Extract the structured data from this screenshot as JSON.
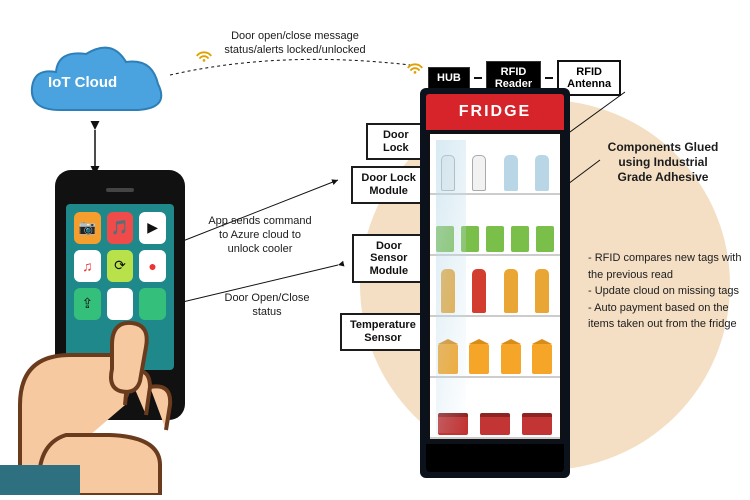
{
  "cloud": {
    "label": "IoT Cloud"
  },
  "hub_row": {
    "hub": "HUB",
    "rfid_reader": "RFID\nReader",
    "rfid_antenna": "RFID\nAntenna"
  },
  "fridge": {
    "sign": "FRIDGE"
  },
  "modules": {
    "door_lock": "Door\nLock",
    "door_lock_module": "Door Lock\nModule",
    "door_sensor_module": "Door\nSensor\nModule",
    "temperature_sensor": "Temperature\nSensor"
  },
  "notes": {
    "top_link": "Door open/close message\nstatus/alerts\nlocked/unlocked",
    "app_to_hub": "App sends command\nto Azure cloud to\nunlock cooler",
    "door_status": "Door Open/Close\nstatus",
    "glued": "Components Glued\nusing Industrial\nGrade Adhesive"
  },
  "right_list": [
    "RFID compares new tags with the previous read",
    "Update cloud on missing tags",
    "Auto payment based on the items taken out from the fridge"
  ],
  "phone_apps": [
    "📷",
    "🎵",
    "▶",
    "♫",
    "⟳",
    "●",
    "⇪",
    "",
    ""
  ]
}
